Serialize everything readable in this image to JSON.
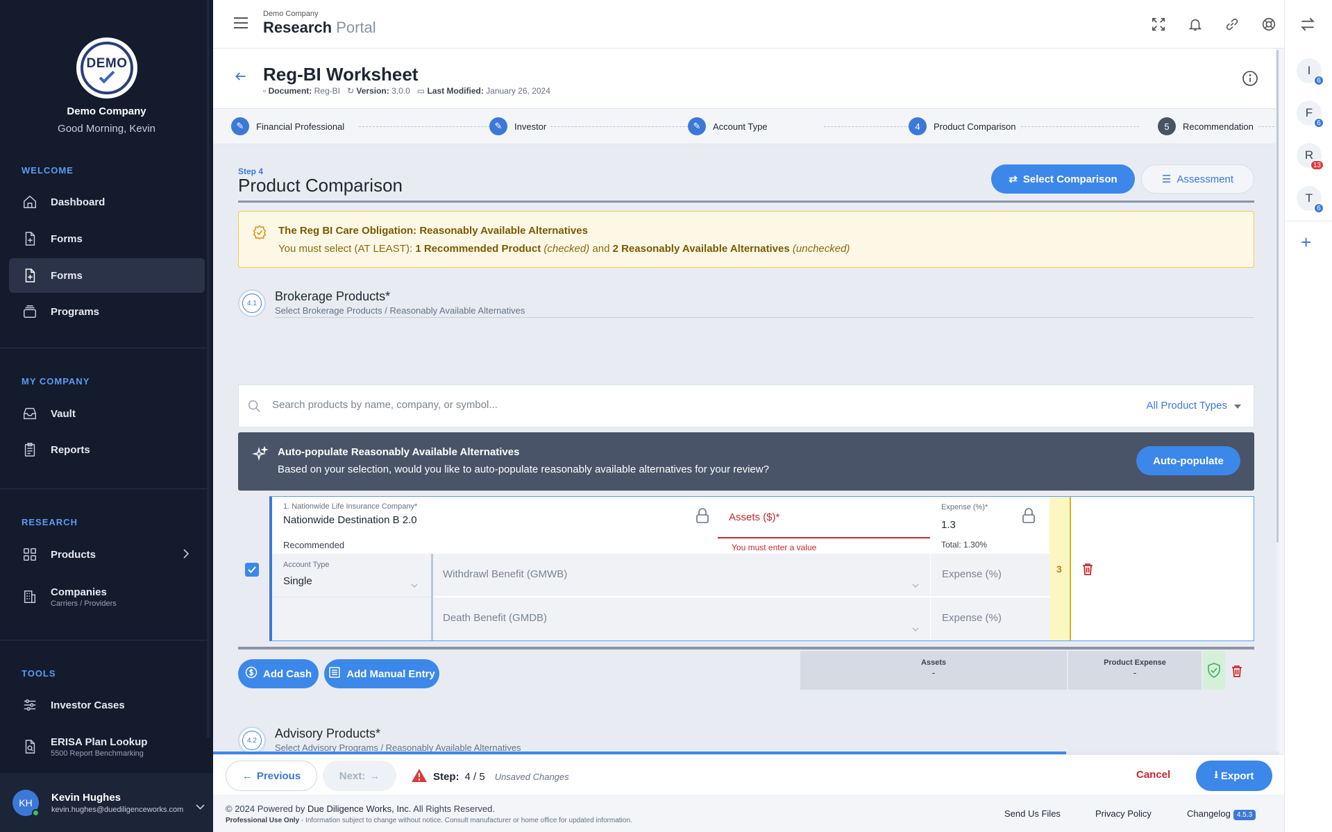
{
  "sidebar": {
    "logo_text": "DEMO",
    "company": "Demo Company",
    "greeting": "Good Morning, Kevin",
    "sections": {
      "welcome": "WELCOME",
      "my_company": "MY COMPANY",
      "research": "RESEARCH",
      "tools": "TOOLS"
    },
    "items": {
      "dashboard": "Dashboard",
      "forms1": "Forms",
      "forms2": "Forms",
      "programs": "Programs",
      "vault": "Vault",
      "reports": "Reports",
      "products": "Products",
      "companies": "Companies",
      "companies_sub": "Carriers / Providers",
      "investor_cases": "Investor Cases",
      "erisa": "ERISA Plan Lookup",
      "erisa_sub": "5500 Report Benchmarking"
    },
    "user": {
      "initials": "KH",
      "name": "Kevin Hughes",
      "email": "kevin.hughes@duediligenceworks.com"
    }
  },
  "topbar": {
    "company_small": "Demo Company",
    "brand_bold": "Research",
    "brand_light": "Portal"
  },
  "rail": {
    "avatars": [
      {
        "letter": "I",
        "badge": "6",
        "color": "blue"
      },
      {
        "letter": "F",
        "badge": "6",
        "color": "blue"
      },
      {
        "letter": "R",
        "badge": "13",
        "color": "red"
      },
      {
        "letter": "T",
        "badge": "6",
        "color": "blue"
      }
    ],
    "add": "+"
  },
  "document": {
    "title": "Reg-BI Worksheet",
    "doc_label": "Document:",
    "doc_value": "Reg-BI",
    "version_label": "Version:",
    "version_value": "3.0.0",
    "modified_label": "Last Modified:",
    "modified_value": "January 26, 2024"
  },
  "steps": [
    {
      "label": "Financial Professional",
      "marker": "edit"
    },
    {
      "label": "Investor",
      "marker": "edit"
    },
    {
      "label": "Account Type",
      "marker": "edit"
    },
    {
      "label": "Product Comparison",
      "marker": "4"
    },
    {
      "label": "Recommendation",
      "marker": "5"
    }
  ],
  "page": {
    "step_small": "Step 4",
    "heading": "Product Comparison",
    "select_comparison": "Select Comparison",
    "assessment": "Assessment"
  },
  "alert": {
    "title": "The Reg BI Care Obligation: Reasonably Available Alternatives",
    "body_1": "You must select (AT LEAST): ",
    "body_2": "1 Recommended Product",
    "body_3": " (checked)",
    "body_4": " and ",
    "body_5": "2 Reasonably Available Alternatives",
    "body_6": " (unchecked)"
  },
  "brokerage": {
    "badge": "4.1",
    "title": "Brokerage Products*",
    "subtitle": "Select Brokerage Products / Reasonably Available Alternatives"
  },
  "search": {
    "placeholder": "Search products by name, company, or symbol...",
    "type_filter": "All Product Types"
  },
  "autopopulate": {
    "title": "Auto-populate Reasonably Available Alternatives",
    "body": "Based on your selection, would you like to auto-populate reasonably available alternatives for your review?",
    "button": "Auto-populate"
  },
  "product": {
    "company_label": "1. Nationwide Life Insurance Company*",
    "name": "Nationwide Destination B 2.0",
    "status": "Recommended",
    "assets_label": "Assets ($)*",
    "assets_error": "You must enter a value",
    "expense_label": "Expense (%)*",
    "expense_value": "1.3",
    "total": "Total: 1.30%",
    "account_type_label": "Account Type",
    "account_type_value": "Single",
    "gmwb_placeholder": "Withdrawl Benefit (GMWB)",
    "gmdb_placeholder": "Death Benefit (GMDB)",
    "expense_placeholder_1": "Expense (%)",
    "expense_placeholder_2": "Expense (%)",
    "score": "3",
    "checked": true
  },
  "actions": {
    "add_cash": "Add Cash",
    "add_manual": "Add Manual Entry"
  },
  "summary": {
    "assets_label": "Assets",
    "assets_value": "-",
    "expense_label": "Product Expense",
    "expense_value": "-"
  },
  "advisory": {
    "badge": "4.2",
    "title": "Advisory Products*",
    "subtitle": "Select Advisory Programs / Reasonably Available Alternatives"
  },
  "progress": 0.8,
  "footer_nav": {
    "previous": "Previous",
    "next": "Next:",
    "step_label": "Step:",
    "step_value": "4 / 5",
    "unsaved": "Unsaved Changes",
    "cancel": "Cancel",
    "export": "Export"
  },
  "footer": {
    "copyright_1": "© 2024 Powered by ",
    "copyright_2": "Due Diligence Works, Inc.",
    "copyright_3": " All Rights Reserved.",
    "disclaimer_bold": "Professional Use Only",
    "disclaimer": " - Information subject to change without notice. Consult manufacturer or home office for updated information.",
    "send_files": "Send Us Files",
    "privacy": "Privacy Policy",
    "changelog": "Changelog",
    "version": "4.5.3"
  },
  "colors": {
    "accent": "#3c87ea",
    "sidebar_bg": "#141b2d",
    "alert_bg": "#fdf8e6",
    "error": "#c8282d"
  }
}
